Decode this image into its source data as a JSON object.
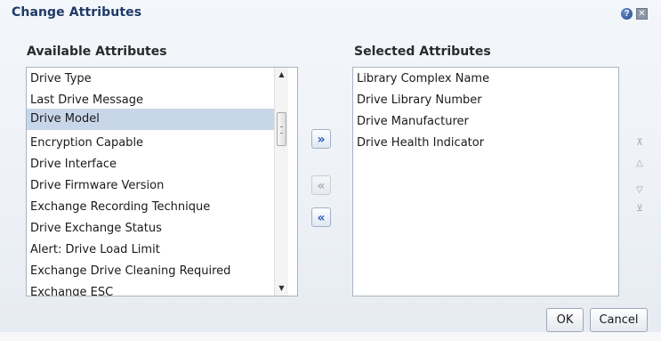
{
  "dialog": {
    "title": "Change Attributes",
    "help_icon": "?",
    "close_icon": "✕"
  },
  "available": {
    "heading": "Available Attributes",
    "items": [
      "Drive Type",
      "Last Drive Message",
      "Drive Model",
      "Encryption Capable",
      "Drive Interface",
      "Drive Firmware Version",
      "Exchange Recording Technique",
      "Drive Exchange Status",
      "Alert: Drive Load Limit",
      "Exchange Drive Cleaning Required",
      "Exchange ESC"
    ],
    "selected_item": "Drive Model"
  },
  "selected": {
    "heading": "Selected Attributes",
    "items": [
      "Library Complex Name",
      "Drive Library Number",
      "Drive Manufacturer",
      "Drive Health Indicator"
    ]
  },
  "shuttle": {
    "move": "»",
    "remove": "«",
    "remove_all": "«"
  },
  "reorder": {
    "top": "⊼",
    "up": "△",
    "down": "▽",
    "bottom": "⊻"
  },
  "footer": {
    "ok_label": "OK",
    "cancel_label": "Cancel"
  }
}
